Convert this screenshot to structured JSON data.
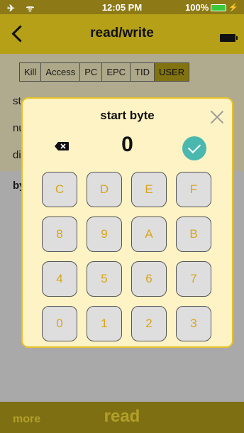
{
  "status_bar": {
    "time": "12:05 PM",
    "battery": "100%",
    "icons": [
      "airplane-icon",
      "wifi-icon",
      "battery-icon",
      "charging-bolt-icon"
    ]
  },
  "nav": {
    "title": "read/write",
    "icons": [
      "chevron-left-icon",
      "battery-icon"
    ]
  },
  "tabs": [
    {
      "label": "Kill",
      "active": false
    },
    {
      "label": "Access",
      "active": false
    },
    {
      "label": "PC",
      "active": false
    },
    {
      "label": "EPC",
      "active": false
    },
    {
      "label": "TID",
      "active": false
    },
    {
      "label": "USER",
      "active": true
    }
  ],
  "background_rows": {
    "row1": "st",
    "row2": "nu",
    "row3": "di",
    "row4": "by"
  },
  "dialog": {
    "title": "start byte",
    "value": "0",
    "keys": [
      "C",
      "D",
      "E",
      "F",
      "8",
      "9",
      "A",
      "B",
      "4",
      "5",
      "6",
      "7",
      "0",
      "1",
      "2",
      "3"
    ]
  },
  "bottom": {
    "more": "more",
    "read": "read"
  },
  "colors": {
    "accent": "#b5a018",
    "dialog_border": "#e9c12a",
    "key_text": "#d8a51a",
    "confirm": "#4bb8b0"
  }
}
